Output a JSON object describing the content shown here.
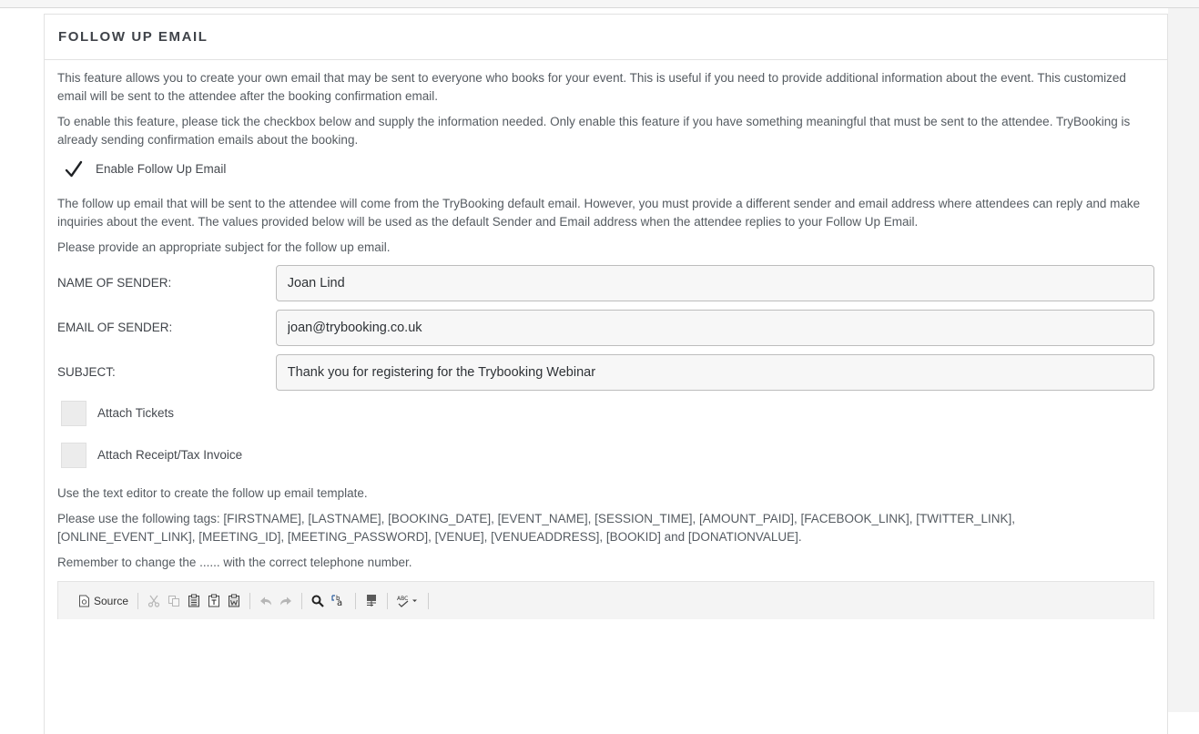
{
  "panel": {
    "title": "FOLLOW UP EMAIL"
  },
  "intro": {
    "paragraph1": "This feature allows you to create your own email that may be sent to everyone who books for your event. This is useful if you need to provide additional information about the event. This customized email will be sent to the attendee after the booking confirmation email.",
    "paragraph2": "To enable this feature, please tick the checkbox below and supply the information needed. Only enable this feature if you have something meaningful that must be sent to the attendee. TryBooking is already sending confirmation emails about the booking."
  },
  "enable_checkbox": {
    "label": "Enable Follow Up Email",
    "checked": true
  },
  "sender_info": {
    "paragraph1": "The follow up email that will be sent to the attendee will come from the TryBooking default email. However, you must provide a different sender and email address where attendees can reply and make inquiries about the event. The values provided below will be used as the default Sender and Email address when the attendee replies to your Follow Up Email.",
    "paragraph2": "Please provide an appropriate subject for the follow up email."
  },
  "form": {
    "sender_name_label": "NAME OF SENDER:",
    "sender_name_value": "Joan Lind",
    "sender_email_label": "EMAIL OF SENDER:",
    "sender_email_value": "joan@trybooking.co.uk",
    "subject_label": "SUBJECT:",
    "subject_value": "Thank you for registering for the Trybooking Webinar"
  },
  "attachments": {
    "tickets_label": "Attach Tickets",
    "tickets_checked": false,
    "receipt_label": "Attach Receipt/Tax Invoice",
    "receipt_checked": false
  },
  "editor_info": {
    "line1": "Use the text editor to create the follow up email template.",
    "line2": "Please use the following tags: [FIRSTNAME], [LASTNAME], [BOOKING_DATE], [EVENT_NAME], [SESSION_TIME], [AMOUNT_PAID], [FACEBOOK_LINK], [TWITTER_LINK], [ONLINE_EVENT_LINK], [MEETING_ID], [MEETING_PASSWORD], [VENUE], [VENUEADDRESS], [BOOKID] and [DONATIONVALUE].",
    "line3": "Remember to change the ...... with the correct telephone number."
  },
  "toolbar": {
    "source_label": "Source",
    "icons": [
      "source-icon",
      "cut-icon",
      "copy-icon",
      "paste-icon",
      "paste-text-icon",
      "paste-word-icon",
      "undo-icon",
      "redo-icon",
      "find-icon",
      "replace-icon",
      "select-all-icon",
      "spellcheck-icon"
    ]
  },
  "colors": {
    "text": "#555b61",
    "title": "#3f4349",
    "input_bg": "#f7f7f7",
    "input_border": "#bdbdbd",
    "toolbar_bg": "#f4f4f4"
  }
}
